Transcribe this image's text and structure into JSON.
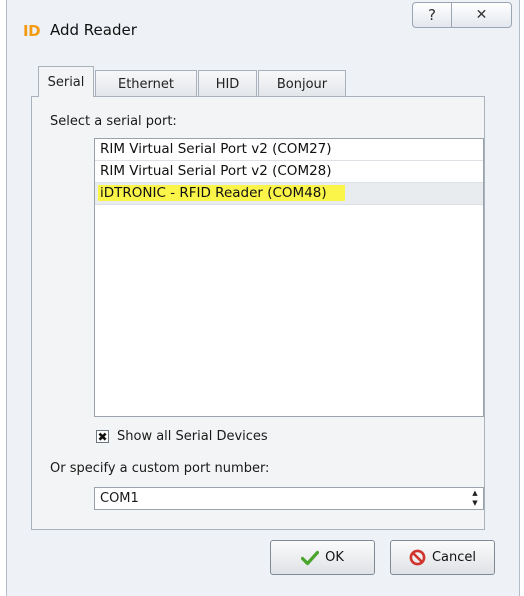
{
  "window": {
    "title_logo": "ID",
    "title": "Add Reader",
    "help_symbol": "?",
    "close_symbol": "✕"
  },
  "tabs": [
    {
      "label": "Serial",
      "active": true
    },
    {
      "label": "Ethernet",
      "active": false
    },
    {
      "label": "HID",
      "active": false
    },
    {
      "label": "Bonjour",
      "active": false
    }
  ],
  "serial": {
    "select_label": "Select a serial port:",
    "ports": [
      "RIM Virtual Serial Port v2 (COM27)",
      "RIM Virtual Serial Port v2 (COM28)",
      "iDTRONIC - RFID Reader (COM48)"
    ],
    "show_all_label": "Show all Serial Devices",
    "show_all_checked": true,
    "custom_label": "Or specify a custom port number:",
    "custom_value": "COM1"
  },
  "buttons": {
    "ok": "OK",
    "cancel": "Cancel"
  },
  "colors": {
    "logo": "#f29a12",
    "highlight": "#fbf54a",
    "ok_icon": "#49a52c",
    "cancel_icon": "#d0342c"
  }
}
